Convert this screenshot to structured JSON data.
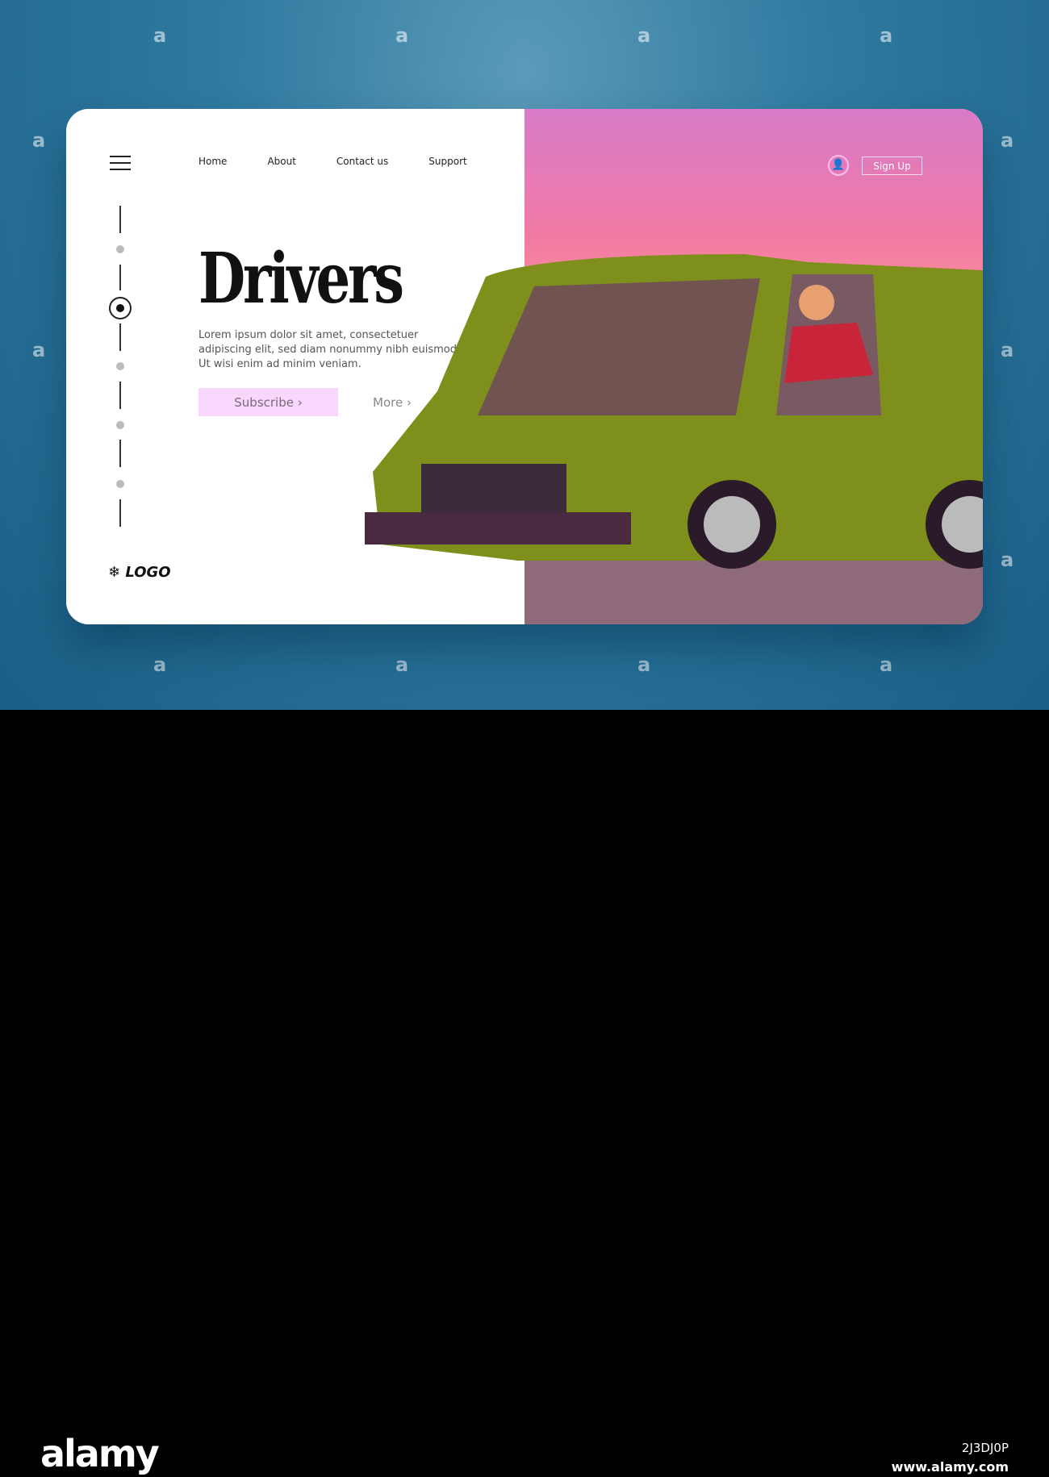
{
  "nav": {
    "items": [
      "Home",
      "About",
      "Contact us",
      "Support"
    ]
  },
  "hero": {
    "title": "Drivers",
    "description": "Lorem ipsum dolor sit amet, consectetuer adipiscing elit, sed diam nonummy nibh euismod Ut wisi enim ad minim veniam.",
    "subscribe_label": "Subscribe ›",
    "more_label": "More ›"
  },
  "logo": {
    "icon": "snowflake-icon",
    "text": "LOGO"
  },
  "header_right": {
    "user_icon": "user-icon",
    "signup_label": "Sign Up"
  },
  "watermark": {
    "mark": "a",
    "brand": "alamy",
    "image_id": "2J3DJ0P",
    "url": "www.alamy.com"
  },
  "colors": {
    "background": "#2f7aa0",
    "subscribe_bg": "#f9d6fb",
    "car": "#7f8f1c",
    "sky": "#f27aa4"
  }
}
